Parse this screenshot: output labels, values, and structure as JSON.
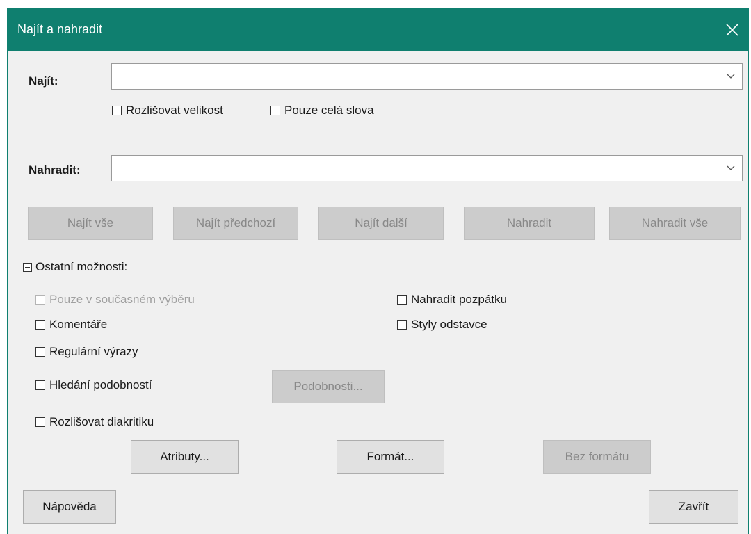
{
  "window": {
    "title": "Najít a nahradit"
  },
  "find": {
    "label": "Najít:",
    "value": "",
    "match_case": "Rozlišovat velikost",
    "whole_words": "Pouze celá slova"
  },
  "replace": {
    "label": "Nahradit:",
    "value": ""
  },
  "buttons": {
    "find_all": "Najít vše",
    "find_prev": "Najít předchozí",
    "find_next": "Najít další",
    "replace": "Nahradit",
    "replace_all": "Nahradit vše"
  },
  "other": {
    "label": "Ostatní možnosti:",
    "only_selection": "Pouze v současném výběru",
    "replace_backwards": "Nahradit pozpátku",
    "comments": "Komentáře",
    "paragraph_styles": "Styly odstavce",
    "regex": "Regulární výrazy",
    "similarity": "Hledání podobností",
    "similarity_button": "Podobnosti...",
    "diacritics": "Rozlišovat diakritiku",
    "attributes": "Atributy...",
    "format": "Formát...",
    "no_format": "Bez formátu"
  },
  "footer": {
    "help": "Nápověda",
    "close": "Zavřít"
  },
  "colors": {
    "titlebar": "#0f7f6f",
    "dialog_bg": "#f0f0f0"
  }
}
